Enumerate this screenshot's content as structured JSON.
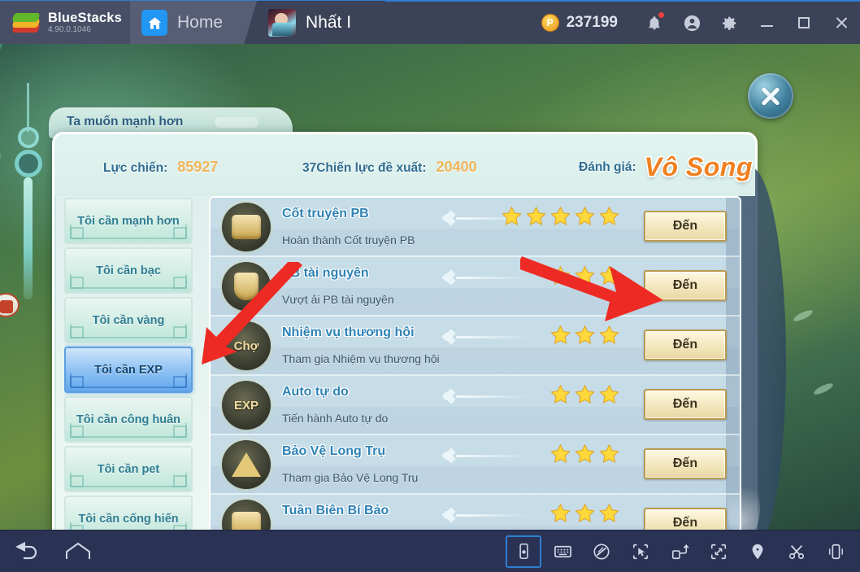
{
  "titlebar": {
    "brand": "BlueStacks",
    "version": "4.90.0.1046",
    "tabs": [
      {
        "label": "Home",
        "icon": "home-icon"
      },
      {
        "label": "Nhất I",
        "icon": "game-avatar-icon"
      }
    ],
    "points_value": "237199",
    "points_icon": "points-coin-icon",
    "icons": [
      "notifications-bell-icon",
      "user-account-icon",
      "settings-gear-icon"
    ],
    "window_controls": [
      "minimize-button",
      "maximize-button",
      "close-button"
    ]
  },
  "panel": {
    "tab_label": "Ta muốn mạnh hơn",
    "stats": {
      "power_label": "Lực chiến:",
      "power_value": "85927",
      "recommended_label": "37Chiến lực đề xuất:",
      "recommended_value": "20400",
      "rating_label": "Đánh giá:",
      "rating_value": "Vô Song"
    },
    "close_icon": "close-x-icon"
  },
  "sidebar": {
    "items": [
      {
        "label": "Tôi cần mạnh hơn",
        "active": false
      },
      {
        "label": "Tôi cần bạc",
        "active": false
      },
      {
        "label": "Tôi cần vàng",
        "active": false
      },
      {
        "label": "Tôi cần EXP",
        "active": true
      },
      {
        "label": "Tôi cần công huân",
        "active": false
      },
      {
        "label": "Tôi cần pet",
        "active": false
      },
      {
        "label": "Tôi cần cống hiến",
        "active": false
      }
    ]
  },
  "tasks": {
    "go_label": "Đến",
    "rows": [
      {
        "name": "Cốt truyện PB",
        "desc": "Hoàn thành Cốt truyện PB",
        "stars": 5,
        "icon": "scroll-book-medallion-icon",
        "icon_glyph": ""
      },
      {
        "name": "PB tài nguyên",
        "desc": "Vượt ải PB tài nguyên",
        "stars": 3,
        "icon": "resource-shield-medallion-icon",
        "icon_glyph": ""
      },
      {
        "name": "Nhiệm vụ thương hội",
        "desc": "Tham gia Nhiệm vụ thương hội",
        "stars": 3,
        "icon": "market-shield-medallion-icon",
        "icon_glyph": "Chợ"
      },
      {
        "name": "Auto tự do",
        "desc": "Tiến hành Auto tự do",
        "stars": 3,
        "icon": "exp-swords-medallion-icon",
        "icon_glyph": "EXP"
      },
      {
        "name": "Bảo Vệ Long Trụ",
        "desc": "Tham gia Bảo Vệ Long Trụ",
        "stars": 3,
        "icon": "dragon-head-medallion-icon",
        "icon_glyph": ""
      },
      {
        "name": "Tuần Biên Bí Bảo",
        "desc": "",
        "stars": 3,
        "icon": "treasure-chest-medallion-icon",
        "icon_glyph": ""
      }
    ]
  },
  "bottombar": {
    "nav": [
      "back-icon",
      "home-icon"
    ],
    "tools": [
      {
        "name": "tilt-device-icon",
        "active": true
      },
      {
        "name": "keyboard-controls-icon",
        "active": false
      },
      {
        "name": "block-ads-icon",
        "active": false
      },
      {
        "name": "macro-pointer-icon",
        "active": false
      },
      {
        "name": "rotate-screen-icon",
        "active": false
      },
      {
        "name": "fullscreen-icon",
        "active": false
      },
      {
        "name": "location-pin-icon",
        "active": false
      },
      {
        "name": "screenshot-scissors-icon",
        "active": false
      },
      {
        "name": "shake-device-icon",
        "active": false
      }
    ]
  },
  "colors": {
    "titlebar_bg": "#3c4257",
    "accent_blue": "#2e7fd4",
    "panel_bg": "#e2f2ee",
    "selected_item": "#63a7ec",
    "rating_orange": "#f08020",
    "annotation_red": "#ee2a24"
  }
}
